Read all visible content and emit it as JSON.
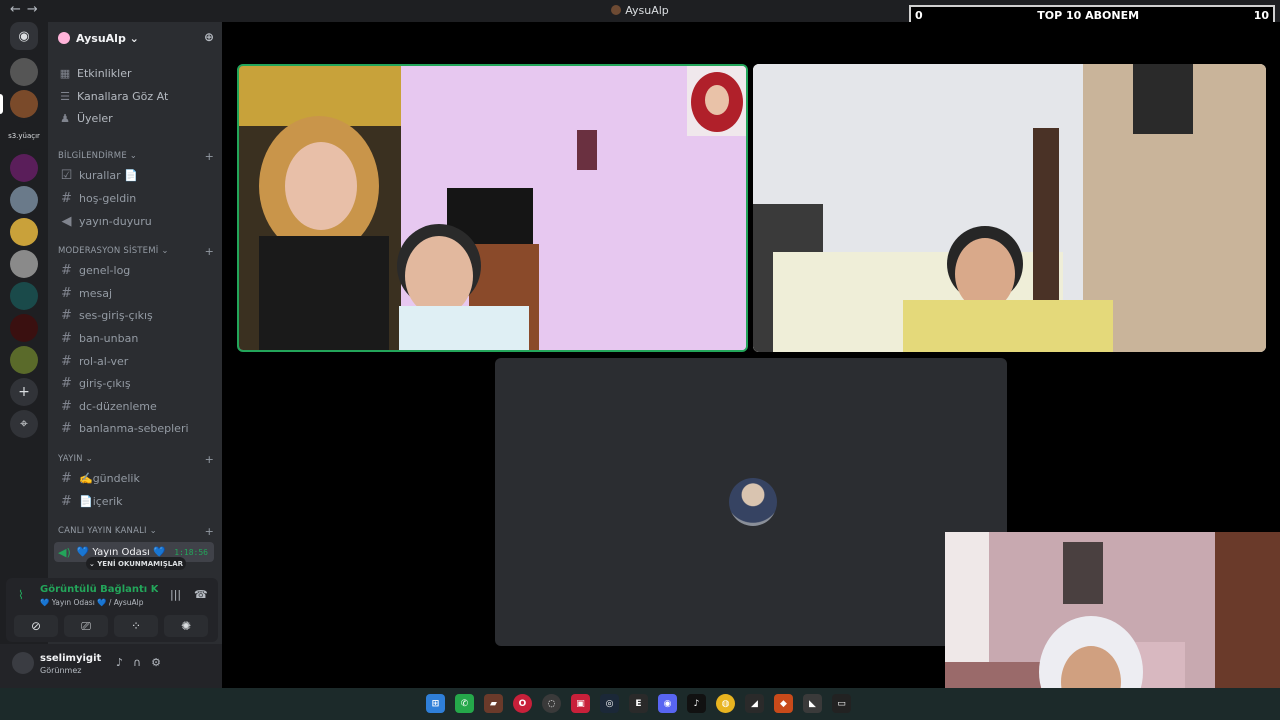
{
  "window": {
    "title": "AysuAlp",
    "nav_back": "←",
    "nav_forward": "→",
    "controls": [
      "▭",
      "?",
      "—",
      "☐",
      "✕"
    ]
  },
  "overlay": {
    "left_value": "0",
    "label": "TOP 10 ABONEM",
    "right_value": "10"
  },
  "server": {
    "name": "AysuAlp ⌄"
  },
  "top_nav": [
    {
      "label": "Etkinlikler",
      "icon": "calendar-icon"
    },
    {
      "label": "Kanallara Göz At",
      "icon": "browse-channels-icon"
    },
    {
      "label": "Üyeler",
      "icon": "members-icon"
    }
  ],
  "rail": {
    "text_server": "s3.yüaçır",
    "colors": [
      "#3a3a3a",
      "#7a4a2a",
      "#1e1f22",
      "#5a1e5a",
      "#4a5a6a",
      "#c9a13a",
      "#3a3c42",
      "#1a4a4a",
      "#3a1010",
      "#5a6a2a"
    ]
  },
  "categories": {
    "bilgilendirme": {
      "title": "BİLGİLENDİRME ⌄",
      "channels": [
        "kurallar 📄",
        "hoş-geldin",
        "yayın-duyuru"
      ]
    },
    "moderasyon": {
      "title": "MODERASYON SİSTEMİ ⌄",
      "channels": [
        "genel-log",
        "mesaj",
        "ses-giriş-çıkış",
        "ban-unban",
        "rol-al-ver",
        "giriş-çıkış",
        "dc-düzenleme",
        "banlanma-sebepleri"
      ]
    },
    "yayin": {
      "title": "YAYIN ⌄",
      "channels": [
        "✍️gündelik",
        "📄içerik"
      ]
    },
    "canli": {
      "title": "CANLI YAYIN KANALI ⌄"
    }
  },
  "voice_channel": {
    "name": "💙 Yayın Odası 💙",
    "timer": "1:18:56",
    "unread": "⌄ YENİ OKUNMAMIŞLAR"
  },
  "voice_panel": {
    "status": "Görüntülü Bağlantı Kuruldu",
    "sub": "💙 Yayın Odası 💙 / AysuAlp"
  },
  "user": {
    "name": "sselimyigit",
    "status": "Görünmez"
  }
}
